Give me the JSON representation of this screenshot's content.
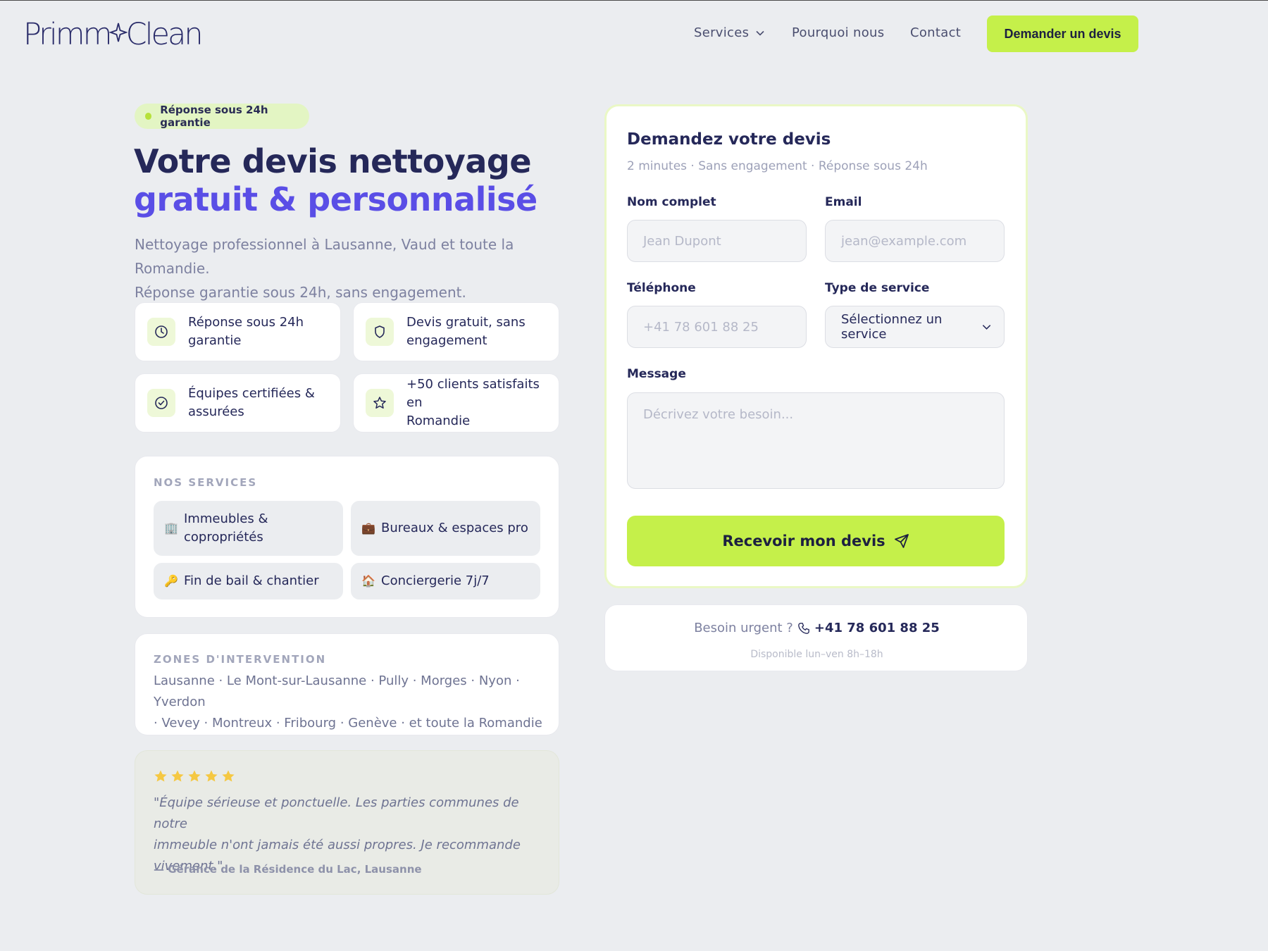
{
  "header": {
    "logo": "Primm Clean",
    "nav": {
      "services": "Services",
      "why": "Pourquoi nous",
      "contact": "Contact"
    },
    "cta": "Demander un devis"
  },
  "hero": {
    "badge": "Réponse sous 24h garantie",
    "title_line1": "Votre devis nettoyage",
    "title_line2": "gratuit & personnalisé",
    "lead_line1": "Nettoyage professionnel à Lausanne, Vaud et toute la Romandie.",
    "lead_line2": "Réponse garantie sous 24h, sans engagement."
  },
  "features": [
    {
      "icon": "clock-icon",
      "line1": "Réponse sous 24h",
      "line2": "garantie"
    },
    {
      "icon": "shield-icon",
      "line1": "Devis gratuit, sans",
      "line2": "engagement"
    },
    {
      "icon": "check-circle-icon",
      "line1": "Équipes certifiées &",
      "line2": "assurées"
    },
    {
      "icon": "star-icon",
      "line1": "+50 clients satisfaits en",
      "line2": "Romandie"
    }
  ],
  "services": {
    "title": "NOS SERVICES",
    "items": [
      {
        "emoji": "🏢",
        "line1": "Immeubles &",
        "line2": "copropriétés"
      },
      {
        "emoji": "💼",
        "line1": "Bureaux & espaces pro",
        "line2": ""
      },
      {
        "emoji": "🔑",
        "line1": "Fin de bail & chantier",
        "line2": ""
      },
      {
        "emoji": "🏠",
        "line1": "Conciergerie 7j/7",
        "line2": ""
      }
    ]
  },
  "zones": {
    "title": "ZONES D'INTERVENTION",
    "line1": "Lausanne · Le Mont-sur-Lausanne · Pully · Morges · Nyon · Yverdon",
    "line2": "· Vevey · Montreux · Fribourg · Genève · et toute la Romandie"
  },
  "review": {
    "rating": 5,
    "line1": "\"Équipe sérieuse et ponctuelle. Les parties communes de notre",
    "line2": "immeuble n'ont jamais été aussi propres. Je recommande",
    "line3": "vivement.\"",
    "author": "— Gérance de la Résidence du Lac, Lausanne"
  },
  "form": {
    "title": "Demandez votre devis",
    "subtitle": "2 minutes · Sans engagement · Réponse sous 24h",
    "name_label": "Nom complet",
    "name_placeholder": "Jean Dupont",
    "email_label": "Email",
    "email_placeholder": "jean@example.com",
    "phone_label": "Téléphone",
    "phone_placeholder": "+41 78 601 88 25",
    "service_label": "Type de service",
    "service_value": "Sélectionnez un service",
    "message_label": "Message",
    "message_placeholder": "Décrivez votre besoin...",
    "submit": "Recevoir mon devis"
  },
  "urgent": {
    "label": "Besoin urgent ?",
    "phone": "+41 78 601 88 25",
    "hours": "Disponible lun–ven 8h–18h"
  },
  "colors": {
    "accent_lime": "#c5f04a",
    "navy": "#252859",
    "violet": "#5a4ee6",
    "star": "#f5c842"
  }
}
